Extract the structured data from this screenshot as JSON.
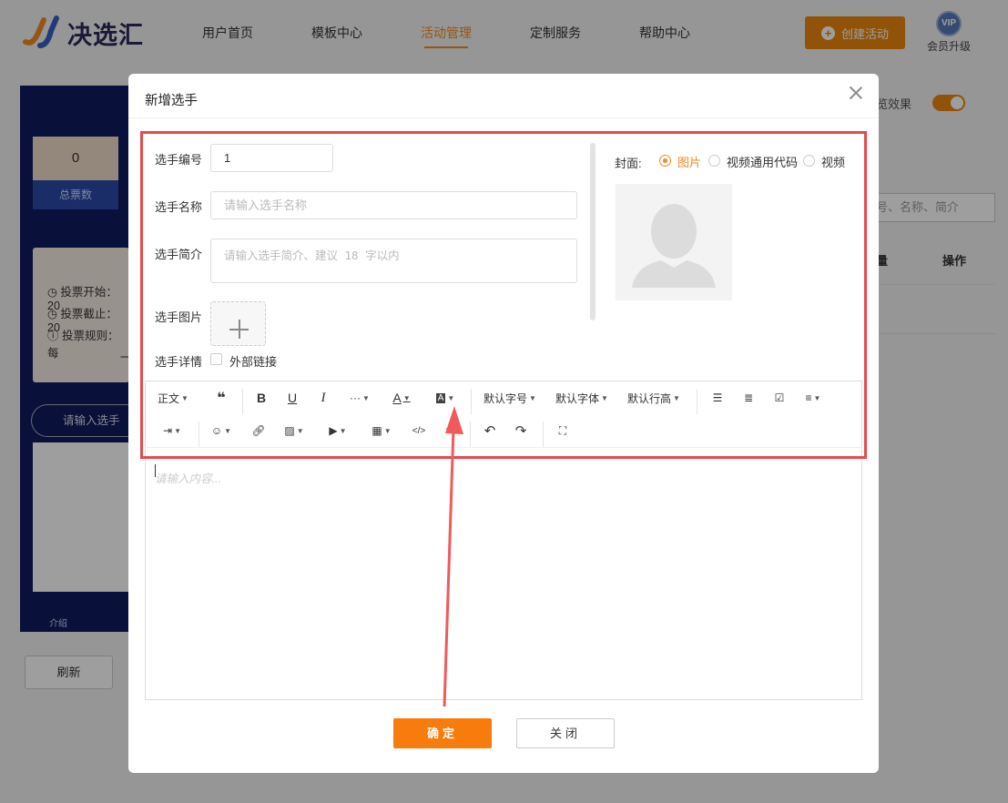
{
  "header": {
    "logo_text": "决选汇",
    "nav": [
      {
        "label": "用户首页"
      },
      {
        "label": "模板中心"
      },
      {
        "label": "活动管理",
        "active": true
      },
      {
        "label": "定制服务"
      },
      {
        "label": "帮助中心"
      }
    ],
    "create_button": "创建活动",
    "vip_badge": "VIP",
    "vip_label": "会员升级"
  },
  "background": {
    "stat_value": "0",
    "stat_label": "总票数",
    "info": [
      "投票开始：20",
      "投票截止：20",
      "投票规则：每"
    ],
    "info_extra": "一",
    "search_placeholder": "请输入选手编",
    "tab_label": "介绍",
    "refresh_button": "刷新",
    "preview_label": "览效果",
    "right_search_placeholder": "号、名称、简介",
    "table_header_partial": "量",
    "table_header_action": "操作"
  },
  "modal": {
    "title": "新增选手",
    "fields": {
      "number_label": "选手编号",
      "number_value": "1",
      "name_label": "选手名称",
      "name_placeholder": "请输入选手名称",
      "intro_label": "选手简介",
      "intro_placeholder": "请输入选手简介、建议 18 字以内",
      "image_label": "选手图片",
      "detail_label": "选手详情",
      "external_link_label": "外部链接"
    },
    "cover": {
      "label": "封面:",
      "options": [
        {
          "label": "图片",
          "selected": true
        },
        {
          "label": "视频通用代码",
          "selected": false
        },
        {
          "label": "视频",
          "selected": false
        }
      ]
    },
    "toolbar": {
      "paragraph": "正文",
      "font_size": "默认字号",
      "font_family": "默认字体",
      "line_height": "默认行高"
    },
    "editor_placeholder": "请输入内容...",
    "confirm_button": "确定",
    "close_button": "关闭"
  },
  "colors": {
    "accent": "#f08a24",
    "highlight": "#e64a4a",
    "nav_dark": "#101a5c"
  }
}
